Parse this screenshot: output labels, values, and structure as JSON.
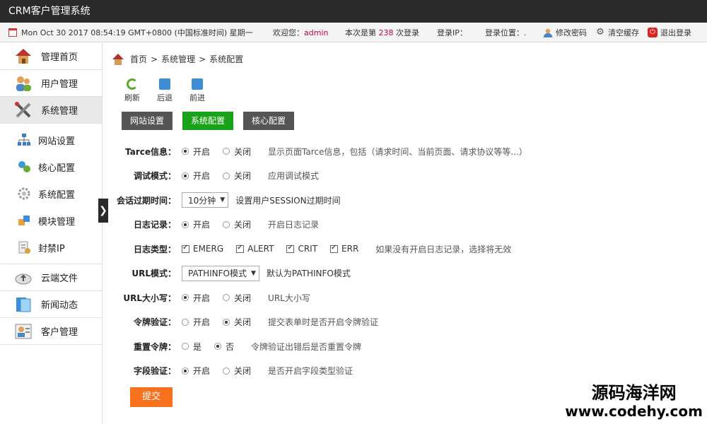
{
  "app": {
    "title": "CRM客户管理系统"
  },
  "infobar": {
    "datetime": "Mon Oct 30 2017 08:54:19 GMT+0800 (中国标准时间) 星期一",
    "welcome_prefix": "欢迎您：",
    "username": "admin",
    "login_count_prefix": "本次是第",
    "login_count": "238",
    "login_count_suffix": "次登录",
    "login_ip": "登录IP：",
    "login_location": "登录位置：.",
    "change_password": "修改密码",
    "clear_cache": "清空缓存",
    "logout": "退出登录"
  },
  "sidebar": {
    "items": [
      {
        "label": "管理首页",
        "icon": "home-icon"
      },
      {
        "label": "用户管理",
        "icon": "users-icon"
      },
      {
        "label": "系统管理",
        "icon": "tools-icon"
      }
    ],
    "subitems": [
      {
        "label": "网站设置",
        "icon": "sitemap-icon"
      },
      {
        "label": "核心配置",
        "icon": "core-icon"
      },
      {
        "label": "系统配置",
        "icon": "gear-icon"
      },
      {
        "label": "模块管理",
        "icon": "module-icon"
      },
      {
        "label": "封禁IP",
        "icon": "ban-icon"
      }
    ],
    "bottom_items": [
      {
        "label": "云端文件",
        "icon": "cloud-icon"
      },
      {
        "label": "新闻动态",
        "icon": "news-icon"
      },
      {
        "label": "客户管理",
        "icon": "customer-icon"
      }
    ],
    "toggle": "❯"
  },
  "breadcrumb": {
    "home": "首页",
    "sep": ">",
    "level1": "系统管理",
    "level2": "系统配置"
  },
  "toolbar": {
    "refresh": "刷新",
    "back": "后退",
    "forward": "前进"
  },
  "tabs": [
    "网站设置",
    "系统配置",
    "核心配置"
  ],
  "form": {
    "on": "开启",
    "off": "关闭",
    "yes": "是",
    "no": "否",
    "tarce": {
      "label": "Tarce信息：",
      "hint": "显示页面Tarce信息，包括（请求时间、当前页面、请求协议等等...）"
    },
    "debug": {
      "label": "调试模式：",
      "hint": "应用调试模式"
    },
    "session": {
      "label": "会话过期时间：",
      "value": "10分钟",
      "hint": "设置用户SESSION过期时间"
    },
    "log": {
      "label": "日志记录：",
      "hint": "开启日志记录"
    },
    "logtype": {
      "label": "日志类型：",
      "types": [
        "EMERG",
        "ALERT",
        "CRIT",
        "ERR"
      ],
      "hint": "如果没有开启日志记录，选择将无效"
    },
    "urlmode": {
      "label": "URL模式：",
      "value": "PATHINFO模式",
      "hint": "默认为PATHINFO模式"
    },
    "urlcase": {
      "label": "URL大小写：",
      "hint": "URL大小写"
    },
    "token": {
      "label": "令牌验证：",
      "hint": "提交表单时是否开启令牌验证"
    },
    "tokenreset": {
      "label": "重置令牌：",
      "hint": "令牌验证出错后是否重置令牌"
    },
    "fieldcheck": {
      "label": "字段验证：",
      "hint": "是否开启字段类型验证"
    },
    "submit": "提交"
  },
  "watermark": {
    "cn": "源码海洋网",
    "en": "www.codehy.com"
  }
}
